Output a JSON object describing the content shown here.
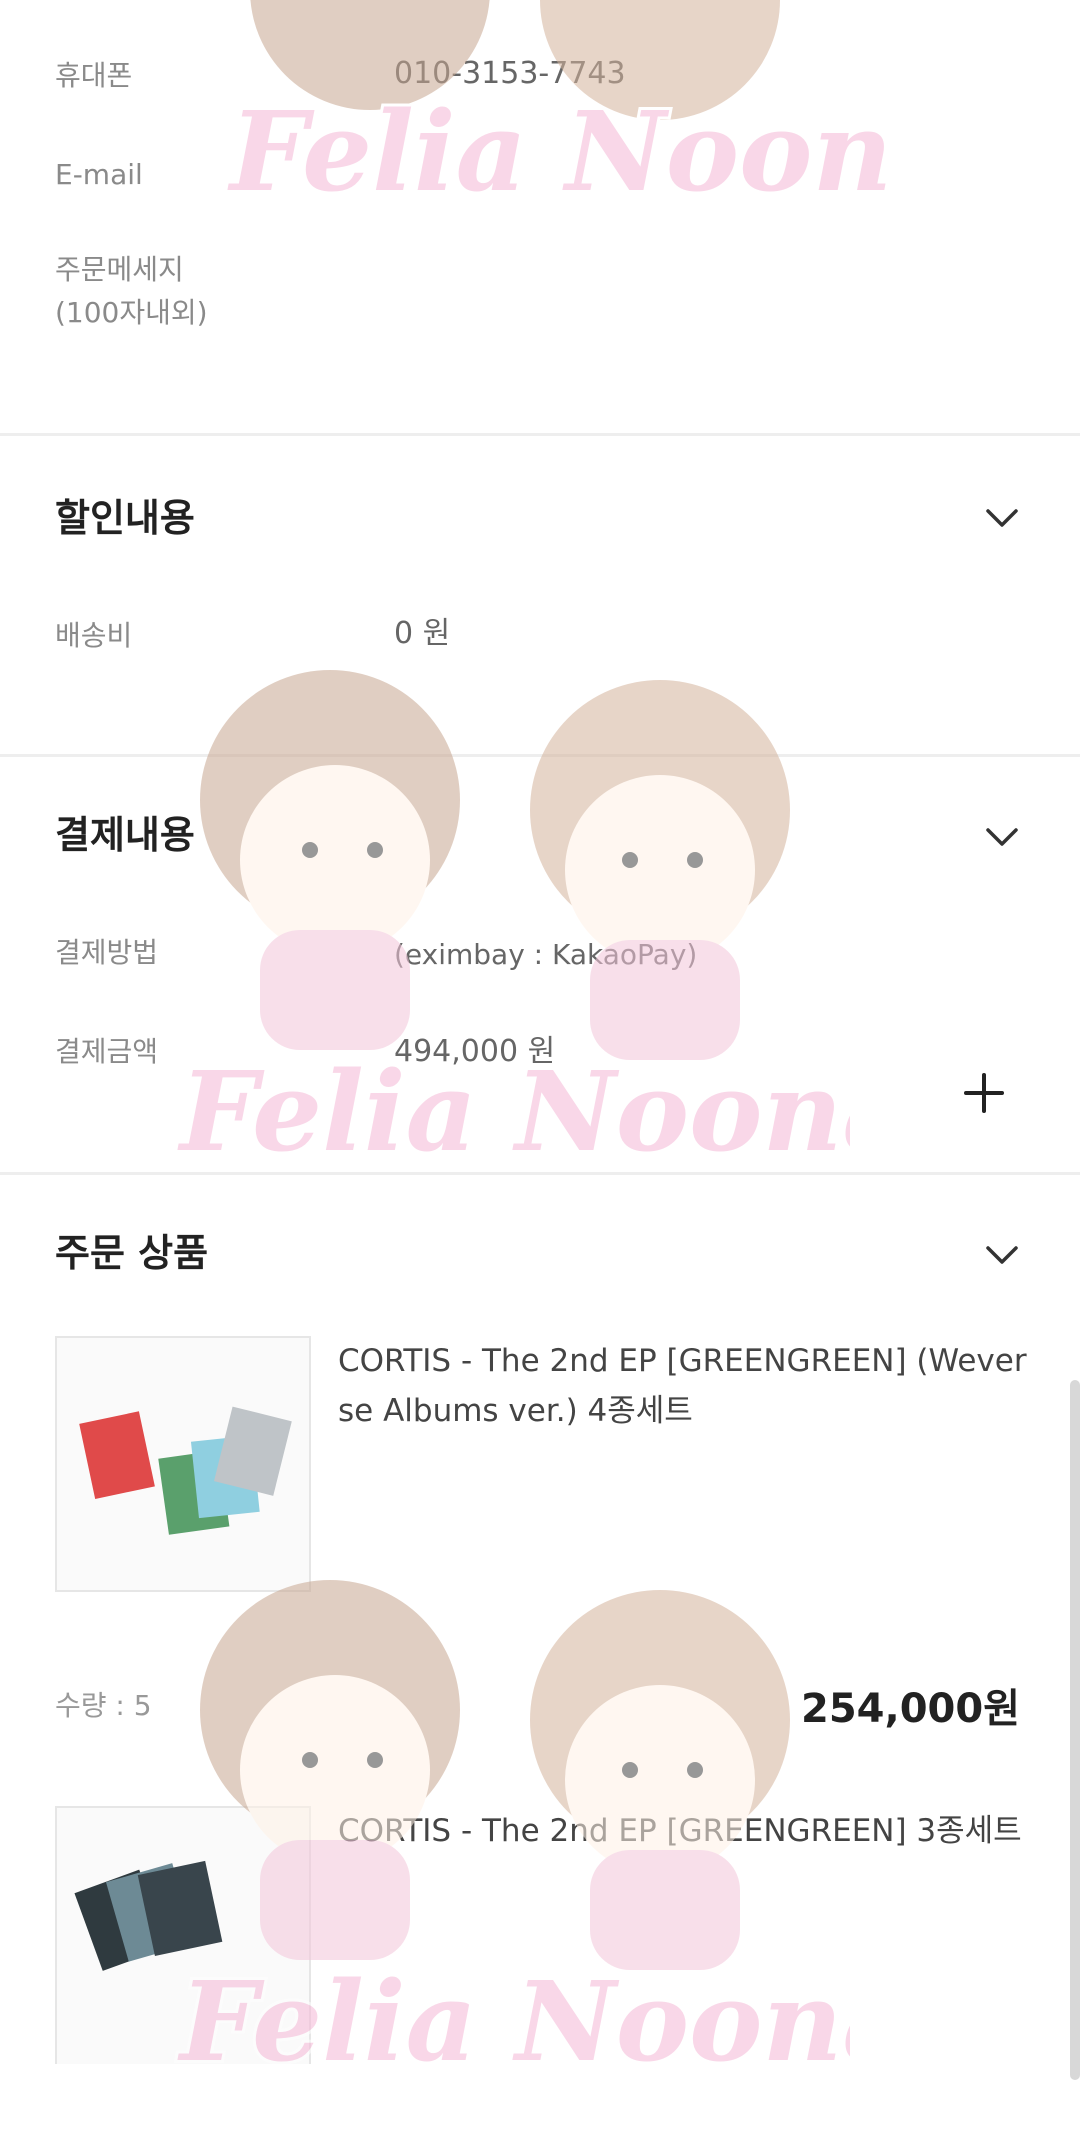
{
  "orderer": {
    "phone_label": "휴대폰",
    "phone_value": "010-3153-7743",
    "email_label": "E-mail",
    "message_label_line1": "주문메세지",
    "message_label_line2": "(100자내외)"
  },
  "discount": {
    "title": "할인내용",
    "shipping_label": "배송비",
    "shipping_value": "0 원"
  },
  "payment": {
    "title": "결제내용",
    "method_label": "결제방법",
    "method_value": "(eximbay : KakaoPay)",
    "amount_label": "결제금액",
    "amount_value": "494,000 원"
  },
  "order_items": {
    "title": "주문 상품",
    "items": [
      {
        "name": "CORTIS - The 2nd EP [GREENGREEN] (Weverse Albums ver.) 4종세트",
        "qty": "수량 : 5",
        "price": "254,000원"
      },
      {
        "name": "CORTIS - The 2nd EP [GREENGREEN] 3종세트"
      }
    ]
  },
  "watermark": {
    "text": "Felia Noona"
  },
  "icons": {
    "chevron": "chevron-down-icon",
    "fab": "plus-icon"
  },
  "colors": {
    "watermark_pink": "#f5b8d6",
    "divider": "#eeeeee"
  }
}
